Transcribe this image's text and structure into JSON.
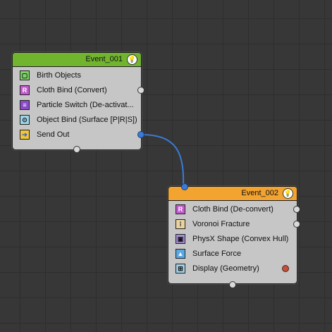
{
  "nodes": {
    "event1": {
      "title": "Event_001",
      "header_color": "#71b52f",
      "operators": [
        {
          "label": "Birth Objects",
          "icon": "birth-objects-icon"
        },
        {
          "label": "Cloth Bind (Convert)",
          "icon": "cloth-bind-icon"
        },
        {
          "label": "Particle Switch (De-activat...",
          "icon": "particle-switch-icon"
        },
        {
          "label": "Object Bind (Surface [P|R|S])",
          "icon": "object-bind-icon"
        },
        {
          "label": "Send Out",
          "icon": "send-out-icon"
        }
      ]
    },
    "event2": {
      "title": "Event_002",
      "header_color": "#f3a330",
      "operators": [
        {
          "label": "Cloth Bind (De-convert)",
          "icon": "cloth-bind-icon"
        },
        {
          "label": "Voronoi Fracture",
          "icon": "voronoi-fracture-icon"
        },
        {
          "label": "PhysX Shape (Convex Hull)",
          "icon": "physx-shape-icon"
        },
        {
          "label": "Surface Force",
          "icon": "surface-force-icon"
        },
        {
          "label": "Display (Geometry)",
          "icon": "display-geometry-icon"
        }
      ]
    }
  },
  "colors": {
    "wire": "#3b7bd8",
    "port_active": "#3b7bd8",
    "display_port": "#c0513b"
  }
}
